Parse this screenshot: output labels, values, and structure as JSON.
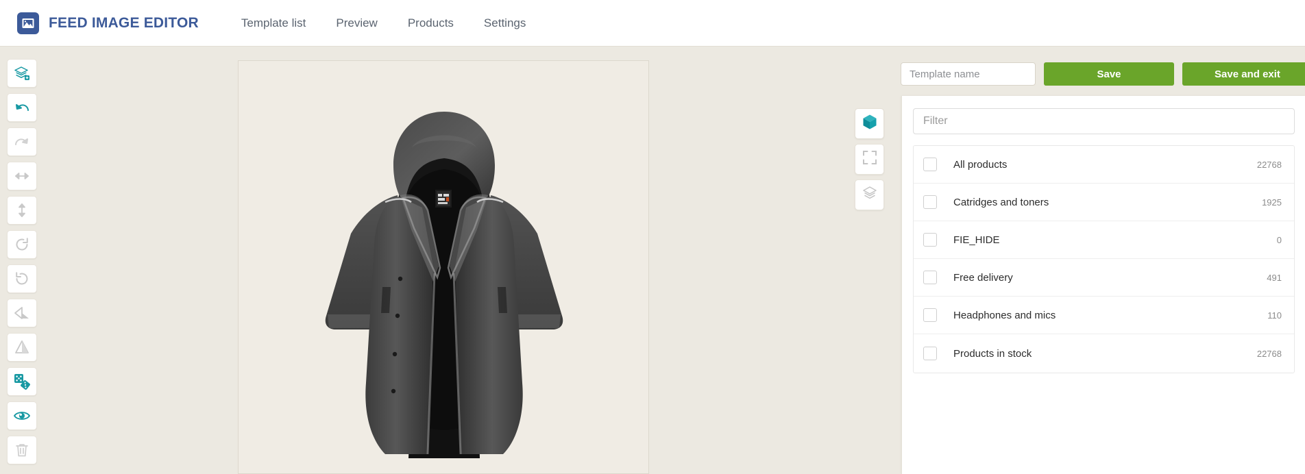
{
  "app": {
    "brand_title": "FEED IMAGE EDITOR",
    "logo_icon": "image-icon",
    "brand_color": "#3c5a99",
    "accent_color": "#6aa52a",
    "teal_color": "#1899a3"
  },
  "nav": {
    "links": [
      {
        "label": "Template list",
        "name": "nav-template-list"
      },
      {
        "label": "Preview",
        "name": "nav-preview"
      },
      {
        "label": "Products",
        "name": "nav-products"
      },
      {
        "label": "Settings",
        "name": "nav-settings"
      }
    ]
  },
  "toolbar": {
    "items": [
      {
        "icon": "add-layer-icon",
        "label": "Add layer",
        "state": "active"
      },
      {
        "icon": "undo-icon",
        "label": "Undo",
        "state": "active"
      },
      {
        "icon": "redo-icon",
        "label": "Redo",
        "state": "disabled"
      },
      {
        "icon": "resize-horizontal-icon",
        "label": "Resize width",
        "state": "disabled"
      },
      {
        "icon": "resize-vertical-icon",
        "label": "Resize height",
        "state": "disabled"
      },
      {
        "icon": "rotate-right-icon",
        "label": "Rotate right",
        "state": "disabled"
      },
      {
        "icon": "rotate-left-icon",
        "label": "Rotate left",
        "state": "disabled"
      },
      {
        "icon": "flip-horizontal-icon",
        "label": "Flip horizontal",
        "state": "disabled"
      },
      {
        "icon": "flip-vertical-icon",
        "label": "Flip vertical",
        "state": "disabled"
      },
      {
        "icon": "dice-icon",
        "label": "Randomize",
        "state": "active"
      },
      {
        "icon": "eye-icon",
        "label": "Preview layer",
        "state": "active"
      },
      {
        "icon": "trash-icon",
        "label": "Delete",
        "state": "disabled"
      }
    ]
  },
  "canvas": {
    "background_color": "#f0ece4",
    "product_image_alt": "Dark grey hooded long coat on black mannequin"
  },
  "actions": {
    "template_name_placeholder": "Template name",
    "template_name_value": "",
    "save_label": "Save",
    "save_and_exit_label": "Save and exit"
  },
  "side_tabs": [
    {
      "icon": "cube-icon",
      "label": "Products",
      "active": true
    },
    {
      "icon": "fullscreen-icon",
      "label": "Canvas",
      "active": false
    },
    {
      "icon": "layers-icon",
      "label": "Layers",
      "active": false
    }
  ],
  "products_panel": {
    "filter_placeholder": "Filter",
    "filter_value": "",
    "rows": [
      {
        "label": "All products",
        "count": "22768",
        "checked": false
      },
      {
        "label": "Catridges and toners",
        "count": "1925",
        "checked": false
      },
      {
        "label": "FIE_HIDE",
        "count": "0",
        "checked": false
      },
      {
        "label": "Free delivery",
        "count": "491",
        "checked": false
      },
      {
        "label": "Headphones and mics",
        "count": "110",
        "checked": false
      },
      {
        "label": "Products in stock",
        "count": "22768",
        "checked": false
      }
    ]
  }
}
